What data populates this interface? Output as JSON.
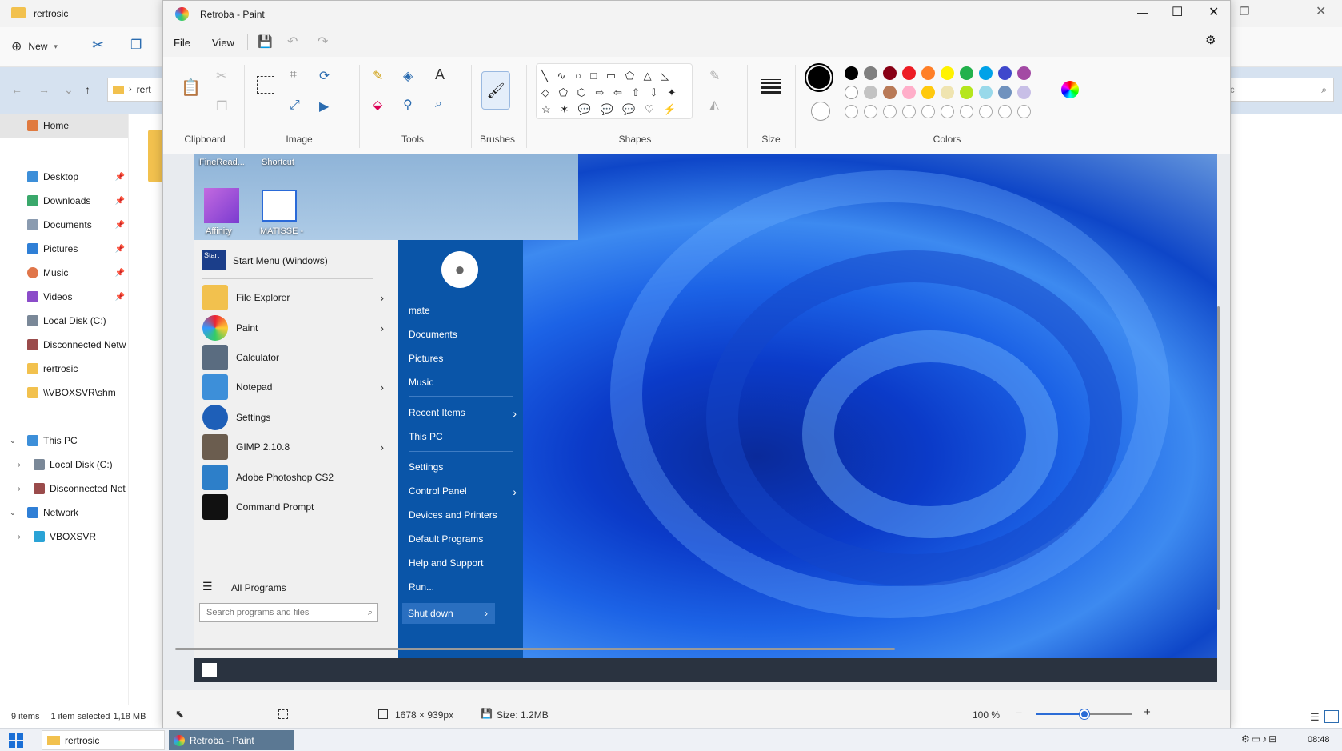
{
  "explorer": {
    "title": "rertrosic",
    "new_label": "New",
    "address": "rert",
    "search_placeholder": "sic",
    "nav": {
      "home": "Home",
      "desktop": "Desktop",
      "downloads": "Downloads",
      "documents": "Documents",
      "pictures": "Pictures",
      "music": "Music",
      "videos": "Videos",
      "local_disk": "Local Disk (C:)",
      "disconnected": "Disconnected Netw",
      "rertrosic": "rertrosic",
      "vboxsvr_shm": "\\\\VBOXSVR\\shm",
      "this_pc": "This PC",
      "local_disk_2": "Local Disk (C:)",
      "disconnected_2": "Disconnected Net",
      "network": "Network",
      "vboxsvr": "VBOXSVR"
    },
    "status_items": "9 items",
    "status_selected": "1 item selected",
    "status_size": "1,18 MB"
  },
  "paint": {
    "title": "Retroba - Paint",
    "menu_file": "File",
    "menu_view": "View",
    "groups": {
      "clipboard": "Clipboard",
      "image": "Image",
      "tools": "Tools",
      "brushes": "Brushes",
      "shapes": "Shapes",
      "size": "Size",
      "colors": "Colors"
    },
    "shape_glyphs_row1": "╲ ∿ ○ □ ▭ ⬠ △ ◺",
    "shape_glyphs_row2": "◇ ⬠ ⬡ ⇨ ⇦ ⇧ ⇩ ✦",
    "shape_glyphs_row3": "☆ ✶ 💬 💬 💬 ♡ ⚡",
    "palette_row1": [
      "#000000",
      "#7f7f7f",
      "#880015",
      "#ed1c24",
      "#ff7f27",
      "#fff200",
      "#22b14c",
      "#00a2e8",
      "#3f48cc",
      "#a349a4"
    ],
    "palette_row2": [
      "#ffffff",
      "#c3c3c3",
      "#b97a57",
      "#ffaec9",
      "#ffc90e",
      "#efe4b0",
      "#b5e61d",
      "#99d9ea",
      "#7092be",
      "#c8bfe7"
    ],
    "status_canvas_size": "1678 × 939px",
    "status_file_size": "Size: 1.2MB",
    "zoom": "100 %",
    "zoom_level": 0.5
  },
  "screenshot": {
    "desktop_icons": [
      "FineRead...",
      "Shortcut",
      "Affinity",
      "MATISSE -"
    ],
    "start_title": "Start Menu (Windows)",
    "start_badge": "Start",
    "programs": [
      "File Explorer",
      "Paint",
      "Calculator",
      "Notepad",
      "Settings",
      "GIMP 2.10.8",
      "Adobe Photoshop CS2",
      "Command Prompt"
    ],
    "all_programs": "All Programs",
    "search_placeholder": "Search programs and files",
    "right": {
      "user": "mate",
      "documents": "Documents",
      "pictures": "Pictures",
      "music": "Music",
      "recent": "Recent Items",
      "this_pc": "This PC",
      "settings": "Settings",
      "control_panel": "Control Panel",
      "devices": "Devices and Printers",
      "default_programs": "Default Programs",
      "help": "Help and Support",
      "run": "Run...",
      "shutdown": "Shut down"
    }
  },
  "taskbar": {
    "explorer_label": "rertrosic",
    "paint_label": "Retroba - Paint",
    "clock": "08:48"
  }
}
